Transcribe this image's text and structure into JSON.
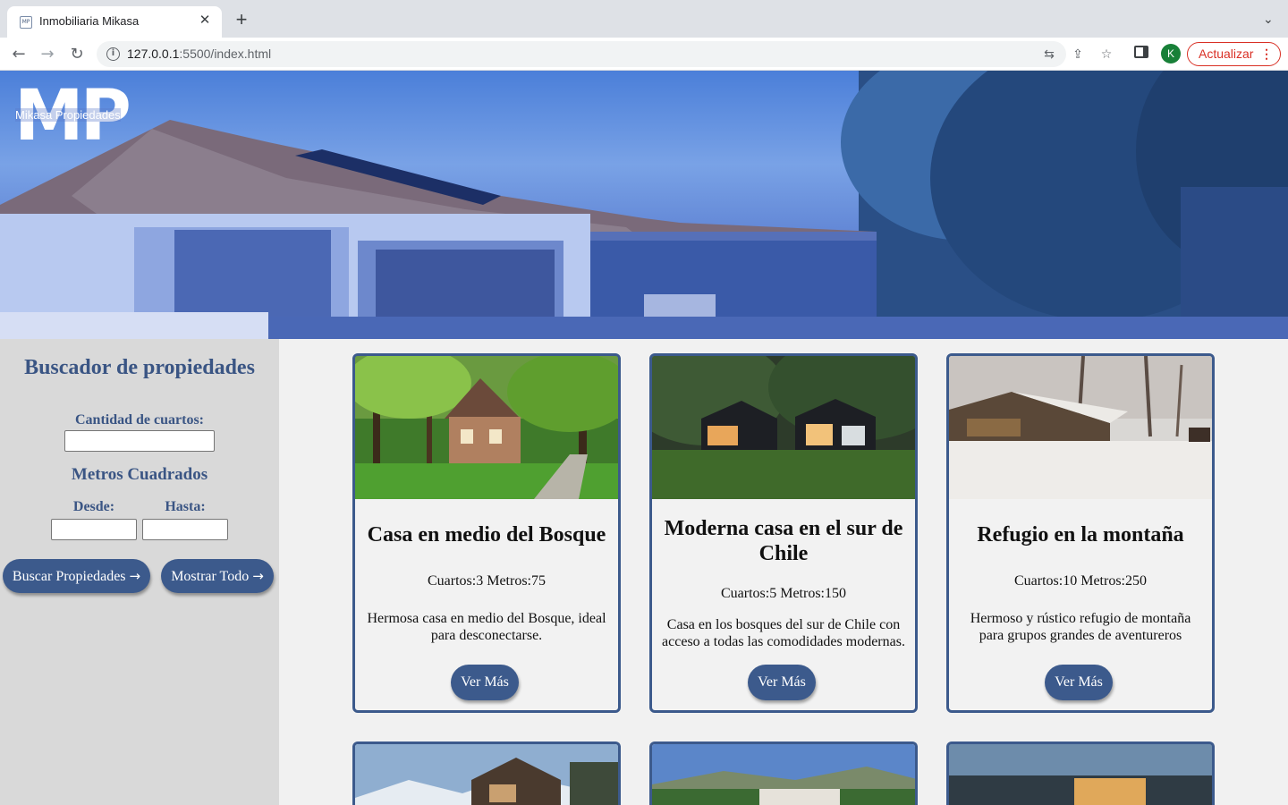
{
  "browser": {
    "tab_title": "Inmobiliaria Mikasa",
    "favicon_text": "MP",
    "url_host": "127.0.0.1",
    "url_rest": ":5500/index.html",
    "profile_initial": "K",
    "update_label": "Actualizar"
  },
  "brand": {
    "logo_mark": "MP",
    "logo_text": "Mikasa Propiedades"
  },
  "search": {
    "title": "Buscador de propiedades",
    "rooms_label": "Cantidad de cuartos:",
    "rooms_value": "",
    "area_title": "Metros Cuadrados",
    "from_label": "Desde:",
    "from_value": "",
    "to_label": "Hasta:",
    "to_value": "",
    "search_button": "Buscar Propiedades",
    "show_all_button": "Mostrar Todo"
  },
  "properties": [
    {
      "title": "Casa en medio del Bosque",
      "meta": "Cuartos:3  Metros:75",
      "description": "Hermosa casa en medio del Bosque, ideal para desconectarse.",
      "button": "Ver Más"
    },
    {
      "title": "Moderna casa en el sur de Chile",
      "meta": "Cuartos:5  Metros:150",
      "description": "Casa en los bosques del sur de Chile con acceso a todas las comodidades modernas.",
      "button": "Ver Más"
    },
    {
      "title": "Refugio en la montaña",
      "meta": "Cuartos:10  Metros:250",
      "description": "Hermoso y rústico refugio de montaña para grupos grandes de aventureros",
      "button": "Ver Más"
    }
  ],
  "colors": {
    "accent": "#3c5a8c",
    "sidebar_bg": "#d9d9d9",
    "page_bg": "#f1f1f1"
  }
}
